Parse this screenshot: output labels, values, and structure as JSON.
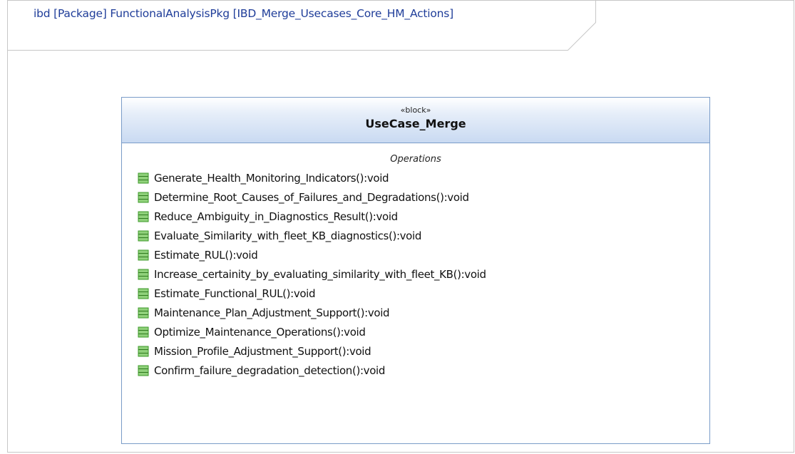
{
  "frame": {
    "title": "ibd [Package] FunctionalAnalysisPkg [IBD_Merge_Usecases_Core_HM_Actions]"
  },
  "block": {
    "stereotype": "«block»",
    "name": "UseCase_Merge",
    "compartment_title": "Operations",
    "operations": [
      "Generate_Health_Monitoring_Indicators():void",
      "Determine_Root_Causes_of_Failures_and_Degradations():void",
      "Reduce_Ambiguity_in_Diagnostics_Result():void",
      "Evaluate_Similarity_with_fleet_KB_diagnostics():void",
      "Estimate_RUL():void",
      "Increase_certainity_by_evaluating_similarity_with_fleet_KB():void",
      "Estimate_Functional_RUL():void",
      "Maintenance_Plan_Adjustment_Support():void",
      "Optimize_Maintenance_Operations():void",
      "Mission_Profile_Adjustment_Support():void",
      "Confirm_failure_degradation_detection():void"
    ]
  },
  "colors": {
    "frame_title": "#1f3d99",
    "block_border": "#7a9cc8",
    "header_gradient_end": "#c9daf2",
    "operation_icon": "#3e9a2a"
  },
  "icons": {
    "operation": "operation-icon"
  }
}
